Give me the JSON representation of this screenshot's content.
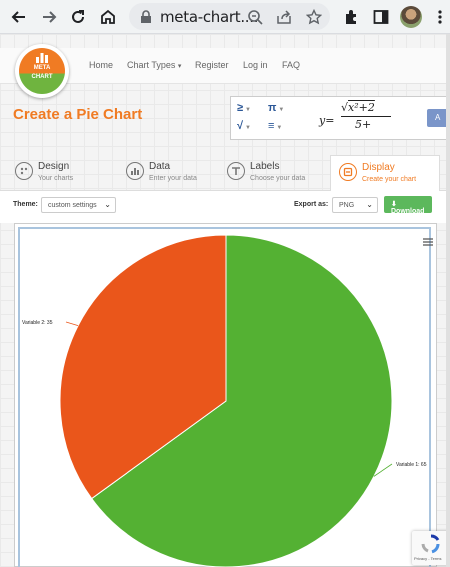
{
  "browser": {
    "url": "meta-chart....",
    "icons": [
      "back-icon",
      "forward-icon",
      "reload-icon",
      "home-icon",
      "lock-icon",
      "zoom-icon",
      "share-icon",
      "star-icon",
      "extensions-icon",
      "sidepanel-icon",
      "menu-icon"
    ]
  },
  "site": {
    "logo_line1": "META",
    "logo_line2": "CHART",
    "nav": [
      "Home",
      "Chart Types",
      "Register",
      "Log in",
      "FAQ"
    ],
    "chart_types_caret": "▾"
  },
  "page": {
    "title": "Create a Pie Chart",
    "equation": {
      "buttons": [
        "≥",
        "π",
        "√",
        "≡"
      ],
      "formula_y": "y=",
      "formula_num": "x²+2",
      "formula_den": "5+"
    }
  },
  "tabs": [
    {
      "title": "Design",
      "subtitle": "Your charts"
    },
    {
      "title": "Data",
      "subtitle": "Enter your data"
    },
    {
      "title": "Labels",
      "subtitle": "Choose your data"
    },
    {
      "title": "Display",
      "subtitle": "Create your chart"
    }
  ],
  "options": {
    "theme_label": "Theme:",
    "theme_value": "custom settings",
    "export_label": "Export as:",
    "export_value": "PNG",
    "download_label": "Download"
  },
  "colors": {
    "accent": "#f07b23",
    "slice1": "#54b133",
    "slice2": "#ea561b"
  },
  "chart_data": {
    "type": "pie",
    "categories": [
      "Variable 1",
      "Variable 2"
    ],
    "values": [
      65,
      35
    ],
    "labels": [
      "Variable 1: 65",
      "Variable 2: 35"
    ],
    "colors": [
      "#54b133",
      "#ea561b"
    ],
    "title": ""
  }
}
